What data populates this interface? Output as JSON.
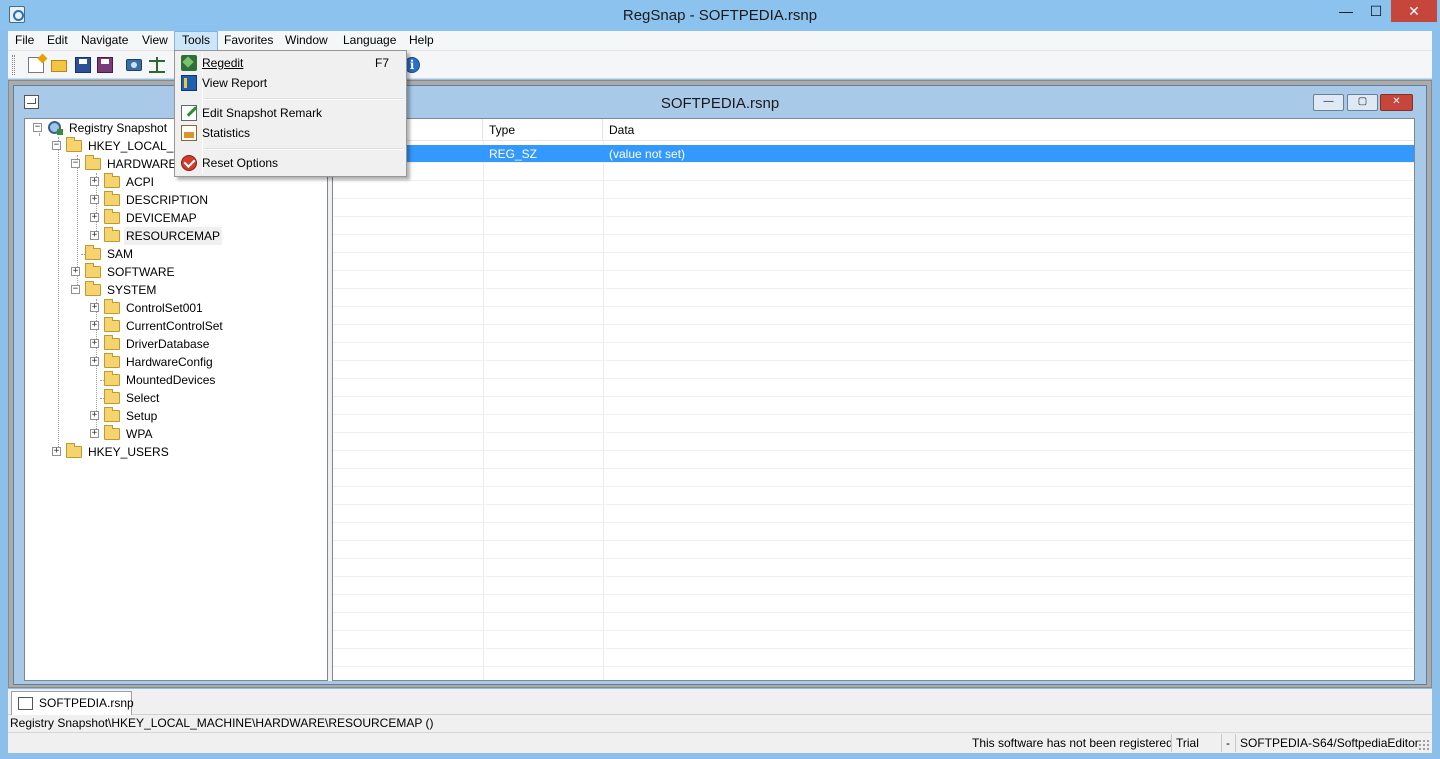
{
  "window": {
    "title": "RegSnap - SOFTPEDIA.rsnp",
    "minimize": "—",
    "maximize": "☐",
    "close": "✕"
  },
  "menubar": [
    "File",
    "Edit",
    "Navigate",
    "View",
    "Tools",
    "Favorites",
    "Window",
    "Language",
    "Help"
  ],
  "toolbar": {
    "icons": [
      "new-snapshot-icon",
      "open-icon",
      "save-icon",
      "save-as-icon",
      "snapshot-icon",
      "compare-icon",
      "about-info-icon"
    ]
  },
  "tools_menu": {
    "items": [
      {
        "label": "Regedit",
        "shortcut": "F7",
        "icon": "regedit-icon"
      },
      {
        "label": "View Report",
        "icon": "view-report-icon"
      },
      {
        "label": "Edit Snapshot Remark",
        "icon": "edit-remark-icon"
      },
      {
        "label": "Statistics",
        "icon": "statistics-icon"
      },
      {
        "label": "Reset Options",
        "icon": "reset-icon"
      }
    ]
  },
  "child_window": {
    "title": "SOFTPEDIA.rsnp",
    "minimize": "—",
    "maximize": "▢",
    "close": "✕"
  },
  "tree": {
    "root": "Registry Snapshot",
    "hklm": "HKEY_LOCAL_MA",
    "hardware": "HARDWARE",
    "acpi": "ACPI",
    "description": "DESCRIPTION",
    "devicemap": "DEVICEMAP",
    "resourcemap": "RESOURCEMAP",
    "sam": "SAM",
    "software": "SOFTWARE",
    "system": "SYSTEM",
    "controlset001": "ControlSet001",
    "currentcontrolset": "CurrentControlSet",
    "driverdatabase": "DriverDatabase",
    "hardwareconfig": "HardwareConfig",
    "mounteddevices": "MountedDevices",
    "select": "Select",
    "setup": "Setup",
    "wpa": "WPA",
    "hku": "HKEY_USERS"
  },
  "list": {
    "columns": [
      "Type",
      "Data"
    ],
    "rows": [
      {
        "type": "REG_SZ",
        "data": "(value not set)"
      }
    ]
  },
  "tab": {
    "label": "SOFTPEDIA.rsnp"
  },
  "path": "Registry Snapshot\\HKEY_LOCAL_MACHINE\\HARDWARE\\RESOURCEMAP ()",
  "status": {
    "registration": "This software has not been registered",
    "mode": "Trial",
    "dash": "-",
    "user": "SOFTPEDIA-S64/SoftpediaEditor"
  },
  "colors": {
    "title_bar": "#8cc2ee",
    "selection": "#3399ff",
    "close_button": "#c7463c"
  }
}
